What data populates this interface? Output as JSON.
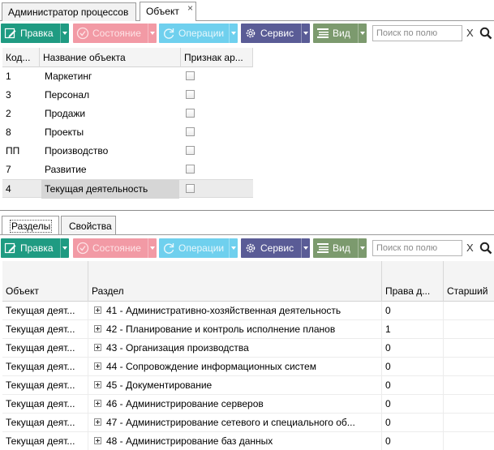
{
  "top_tabs": [
    {
      "label": "Администратор процессов"
    },
    {
      "label": "Объект",
      "close": "×"
    }
  ],
  "toolbar": {
    "pravka": "Правка",
    "sostoyanie": "Состояние",
    "operacii": "Операции",
    "servis": "Сервис",
    "vid": "Вид",
    "search_placeholder": "Поиск по полю",
    "clear": "X"
  },
  "grid1": {
    "headers": [
      "Код...",
      "Название объекта",
      "Признак ар..."
    ],
    "rows": [
      {
        "code": "1",
        "name": "Маркетинг"
      },
      {
        "code": "3",
        "name": "Персонал"
      },
      {
        "code": "2",
        "name": "Продажи"
      },
      {
        "code": "8",
        "name": "Проекты"
      },
      {
        "code": "ПП",
        "name": "Производство"
      },
      {
        "code": "7",
        "name": "Развитие"
      },
      {
        "code": "4",
        "name": "Текущая деятельность"
      }
    ]
  },
  "bottom_tabs": [
    {
      "label": "Разделы"
    },
    {
      "label": "Свойства"
    }
  ],
  "grid2": {
    "headers": [
      "Объект",
      "Раздел",
      "Права д...",
      "Старший"
    ],
    "rows": [
      {
        "object": "Текущая деят...",
        "section": "41 - Административно-хозяйственная деятельность",
        "rights": "0"
      },
      {
        "object": "Текущая деят...",
        "section": "42 - Планирование и контроль исполнение планов",
        "rights": "1"
      },
      {
        "object": "Текущая деят...",
        "section": "43 - Организация производства",
        "rights": "0"
      },
      {
        "object": "Текущая деят...",
        "section": "44 - Сопровождение информационных систем",
        "rights": "0"
      },
      {
        "object": "Текущая деят...",
        "section": "45 - Документирование",
        "rights": "0"
      },
      {
        "object": "Текущая деят...",
        "section": "46 - Администрирование серверов",
        "rights": "0"
      },
      {
        "object": "Текущая деят...",
        "section": "47 - Администрирование сетевого и специального об...",
        "rights": "0"
      },
      {
        "object": "Текущая деят...",
        "section": "48 - Администрирование баз данных",
        "rights": "0"
      }
    ]
  },
  "colors": {
    "pravka": "#1f9b82",
    "sostoyanie": "#f29aa5",
    "operacii": "#6fd0ee",
    "servis": "#5a5c96",
    "vid": "#7c9a6e"
  },
  "icons": [
    "edit-icon",
    "check-circle-icon",
    "refresh-icon",
    "gear-icon",
    "list-view-icon",
    "search-icon",
    "expand-plus-icon",
    "checkbox"
  ]
}
